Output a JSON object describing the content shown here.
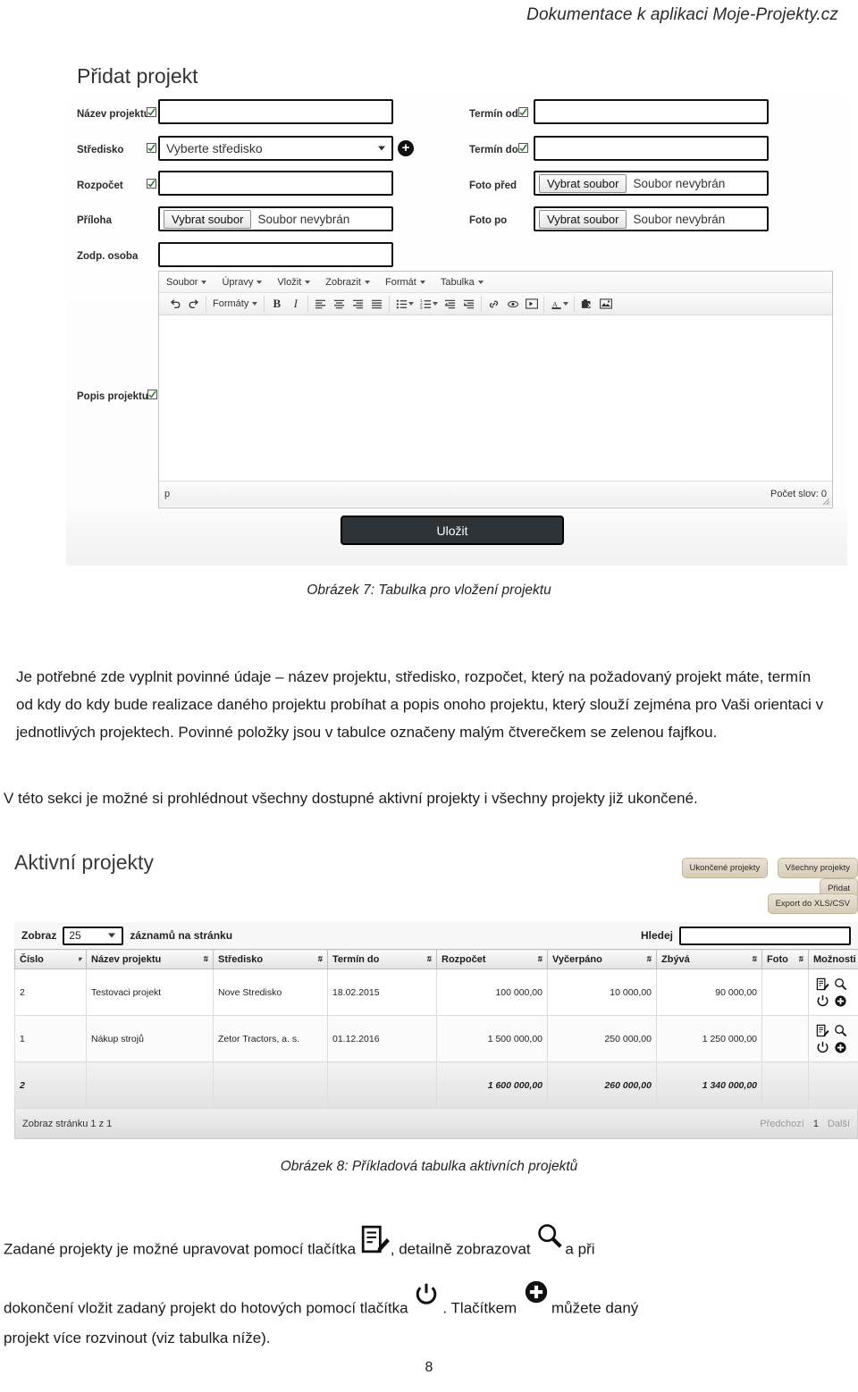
{
  "header": {
    "title": "Dokumentace k aplikaci Moje-Projekty.cz"
  },
  "figure7": {
    "form_title": "Přidat projekt",
    "fields_left": [
      {
        "label": "Název projektu",
        "required": true,
        "value": "",
        "type": "text"
      },
      {
        "label": "Středisko",
        "required": true,
        "value": "Vyberte středisko",
        "type": "select"
      },
      {
        "label": "Rozpočet",
        "required": true,
        "value": "",
        "type": "text"
      },
      {
        "label": "Příloha",
        "required": false,
        "value": "",
        "type": "file"
      },
      {
        "label": "Zodp. osoba",
        "required": false,
        "value": "",
        "type": "text"
      }
    ],
    "fields_right": [
      {
        "label": "Termín od",
        "required": true,
        "value": "",
        "type": "text"
      },
      {
        "label": "Termín do",
        "required": true,
        "value": "",
        "type": "text"
      },
      {
        "label": "Foto před",
        "required": false,
        "value": "",
        "type": "file"
      },
      {
        "label": "Foto po",
        "required": false,
        "value": "",
        "type": "file"
      }
    ],
    "file_button_label": "Vybrat soubor",
    "file_status_label": "Soubor nevybrán",
    "description_label": "Popis projektu",
    "add_center_button": "+",
    "editor": {
      "menus": [
        "Soubor",
        "Úpravy",
        "Vložit",
        "Zobrazit",
        "Formát",
        "Tabulka"
      ],
      "formats_label": "Formáty",
      "status_left": "p",
      "status_right": "Počet slov: 0",
      "content": ""
    },
    "save_button": "Uložit",
    "caption": "Obrázek 7: Tabulka pro vložení projektu"
  },
  "body": {
    "paragraph1": "Je potřebné zde vyplnit povinné údaje – název projektu, středisko, rozpočet, který na požadovaný projekt máte, termín od kdy do kdy bude realizace daného projektu probíhat a popis onoho projektu, který slouží zejména pro Vaši orientaci v jednotlivých projektech. Povinné položky jsou v tabulce označeny malým čtverečkem se zelenou fajfkou.",
    "paragraph2": "V této sekci je možné si prohlédnout všechny dostupné aktivní projekty i všechny projekty již ukončené.",
    "paragraph3_a": "Zadané projekty je možné upravovat pomocí tlačítka",
    "paragraph3_b": ", detailně zobrazovat",
    "paragraph3_c": "a při",
    "paragraph3_d": "dokončení vložit zadaný projekt do hotových pomocí tlačítka",
    "paragraph3_e": ". Tlačítkem",
    "paragraph3_f": "můžete daný",
    "paragraph3_g": "projekt více rozvinout (viz tabulka níže)."
  },
  "figure8": {
    "heading": "Aktivní projekty",
    "buttons": [
      "Ukončené projekty",
      "Všechny projekty",
      "Přidat"
    ],
    "export_button": "Export do XLS/CSV",
    "length_label_before": "Zobraz",
    "length_value": "25",
    "length_label_after": "záznamů na stránku",
    "search_label": "Hledej",
    "search_value": "",
    "columns": [
      "Číslo",
      "Název projektu",
      "Středisko",
      "Termín do",
      "Rozpočet",
      "Vyčerpáno",
      "Zbývá",
      "Foto",
      "Možnosti"
    ],
    "rows": [
      {
        "cislo": "2",
        "nazev": "Testovaci projekt",
        "stredisko": "Nove Stredisko",
        "termin_do": "18.02.2015",
        "rozpocet": "100 000,00",
        "vycerpano": "10 000,00",
        "zbyva": "90 000,00",
        "foto": ""
      },
      {
        "cislo": "1",
        "nazev": "Nákup strojů",
        "stredisko": "Zetor Tractors, a. s.",
        "termin_do": "01.12.2016",
        "rozpocet": "1 500 000,00",
        "vycerpano": "250 000,00",
        "zbyva": "1 250 000,00",
        "foto": ""
      }
    ],
    "footer": {
      "cislo": "2",
      "nazev": "",
      "stredisko": "",
      "termin_do": "",
      "rozpocet": "1 600 000,00",
      "vycerpano": "260 000,00",
      "zbyva": "1 340 000,00",
      "foto": "",
      "moznosti": ""
    },
    "info": "Zobraz stránku 1 z 1",
    "pager": {
      "prev": "Předchozí",
      "current": "1",
      "next": "Další"
    },
    "caption": "Obrázek 8: Příkladová tabulka aktivních projektů"
  },
  "footer": {
    "page_number": "8"
  },
  "colors": {
    "required_check": "#2f7d32",
    "save_button_bg": "#2e3338",
    "pill_bg": "#e0d7c4"
  }
}
